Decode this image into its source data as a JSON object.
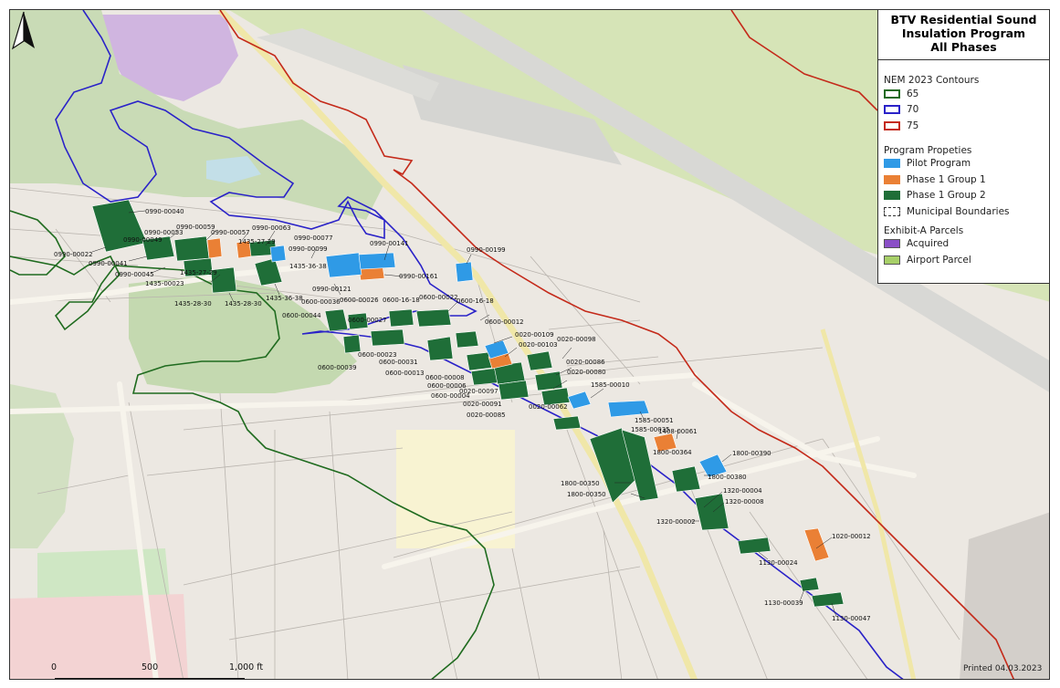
{
  "map": {
    "title_lines": [
      "BTV Residential Sound",
      "Insulation Program",
      "All Phases"
    ],
    "printed": "Printed 04.03.2023",
    "legend": {
      "contours_heading": "NEM 2023 Contours",
      "contours": [
        {
          "label": "65",
          "color": "#1f6b1f"
        },
        {
          "label": "70",
          "color": "#2a22c8"
        },
        {
          "label": "75",
          "color": "#c42a1a"
        }
      ],
      "program_heading": "Program Propeties",
      "program": [
        {
          "label": "Pilot Program",
          "color": "#2f9ae6"
        },
        {
          "label": "Phase 1 Group 1",
          "color": "#ea8035"
        },
        {
          "label": "Phase 1 Group 2",
          "color": "#1f6e38"
        }
      ],
      "municipal_label": "Municipal Boundaries",
      "exhibit_heading": "Exhibit-A Parcels",
      "exhibit": [
        {
          "label": "Acquired",
          "color": "#8a4fc7"
        },
        {
          "label": "Airport Parcel",
          "color": "#a7cf68"
        }
      ]
    },
    "scale": {
      "labels": [
        "0",
        "500",
        "1,000 ft"
      ]
    },
    "north_icon": "north-arrow-icon",
    "parcel_labels": [
      "0990-00040",
      "0990-00053",
      "0990-00059",
      "0990-00057",
      "0990-00063",
      "0990-00077",
      "0990-00049",
      "1435-27-29",
      "0990-00099",
      "0990-00141",
      "0990-00199",
      "0990-00022",
      "0990-00041",
      "0990-00045",
      "1435-27-29",
      "1435-36-38",
      "0990-00161",
      "1435-00023",
      "0990-00121",
      "1435-28-30",
      "1435-28-30",
      "1435-36-38",
      "0600-00036",
      "0600-00026",
      "0600-16-18",
      "0600-00022",
      "0600-16-18",
      "0600-00044",
      "0600-00027",
      "0600-00012",
      "0020-00109",
      "0020-00103",
      "0020-00098",
      "0600-00023",
      "0600-00039",
      "0600-00031",
      "0600-00013",
      "0020-00086",
      "0020-00080",
      "0600-00008",
      "0600-00006",
      "0600-00004",
      "0020-00097",
      "1585-00010",
      "0020-00091",
      "0020-00062",
      "0020-00085",
      "1585-00051",
      "1585-00035",
      "1408-00061",
      "1800-00364",
      "1800-00390",
      "1800-00380",
      "1800-00350",
      "1800-00350",
      "1320-00004",
      "1320-00008",
      "1320-00002",
      "1020-00012",
      "1130-00024",
      "1130-00039",
      "1130-00047"
    ]
  }
}
